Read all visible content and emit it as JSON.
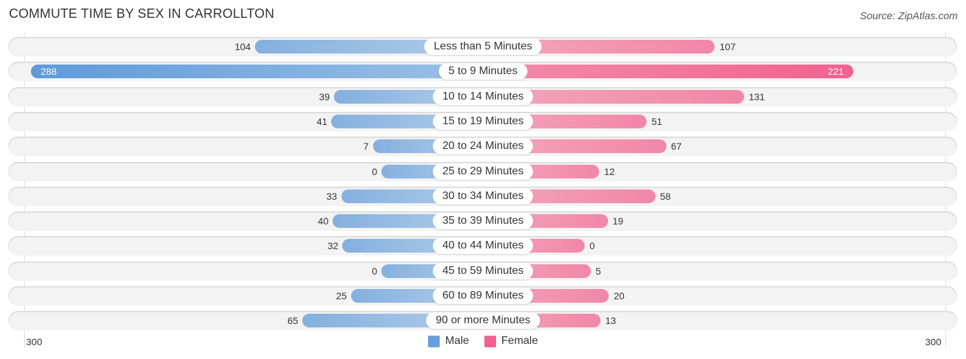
{
  "chart_data": {
    "type": "bar",
    "orientation": "horizontal-diverging",
    "title": "COMMUTE TIME BY SEX IN CARROLLTON",
    "source": "Source: ZipAtlas.com",
    "categories": [
      "Less than 5 Minutes",
      "5 to 9 Minutes",
      "10 to 14 Minutes",
      "15 to 19 Minutes",
      "20 to 24 Minutes",
      "25 to 29 Minutes",
      "30 to 34 Minutes",
      "35 to 39 Minutes",
      "40 to 44 Minutes",
      "45 to 59 Minutes",
      "60 to 89 Minutes",
      "90 or more Minutes"
    ],
    "series": [
      {
        "name": "Male",
        "color": "#6a9fdb",
        "values": [
          104,
          288,
          39,
          41,
          7,
          0,
          33,
          40,
          32,
          0,
          25,
          65
        ]
      },
      {
        "name": "Female",
        "color": "#f06292",
        "values": [
          107,
          221,
          131,
          51,
          67,
          12,
          58,
          19,
          0,
          5,
          20,
          13
        ]
      }
    ],
    "axis": {
      "left_tick": "300",
      "right_tick": "300",
      "range": [
        0,
        300
      ]
    },
    "legend": {
      "placement": "bottom-center",
      "items": [
        "Male",
        "Female"
      ]
    }
  }
}
